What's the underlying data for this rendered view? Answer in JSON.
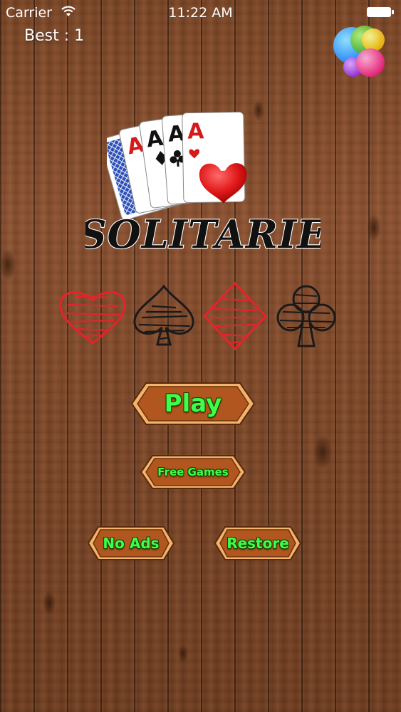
{
  "status_bar": {
    "carrier": "Carrier",
    "time": "11:22 AM",
    "wifi_icon": "wifi-icon",
    "battery_icon": "battery-icon"
  },
  "header": {
    "best_label": "Best : 1",
    "game_center_icon": "game-center-icon"
  },
  "logo": {
    "title": "SOLITARIE",
    "card_letter": "A"
  },
  "buttons": {
    "play": "Play",
    "free_games": "Free Games",
    "no_ads": "No Ads",
    "restore": "Restore"
  },
  "colors": {
    "button_text": "#3dff4a",
    "button_fill": "#b0561e",
    "button_border": "#f2b36b",
    "suit_red": "#e5232b",
    "suit_black": "#1a1a1a"
  }
}
